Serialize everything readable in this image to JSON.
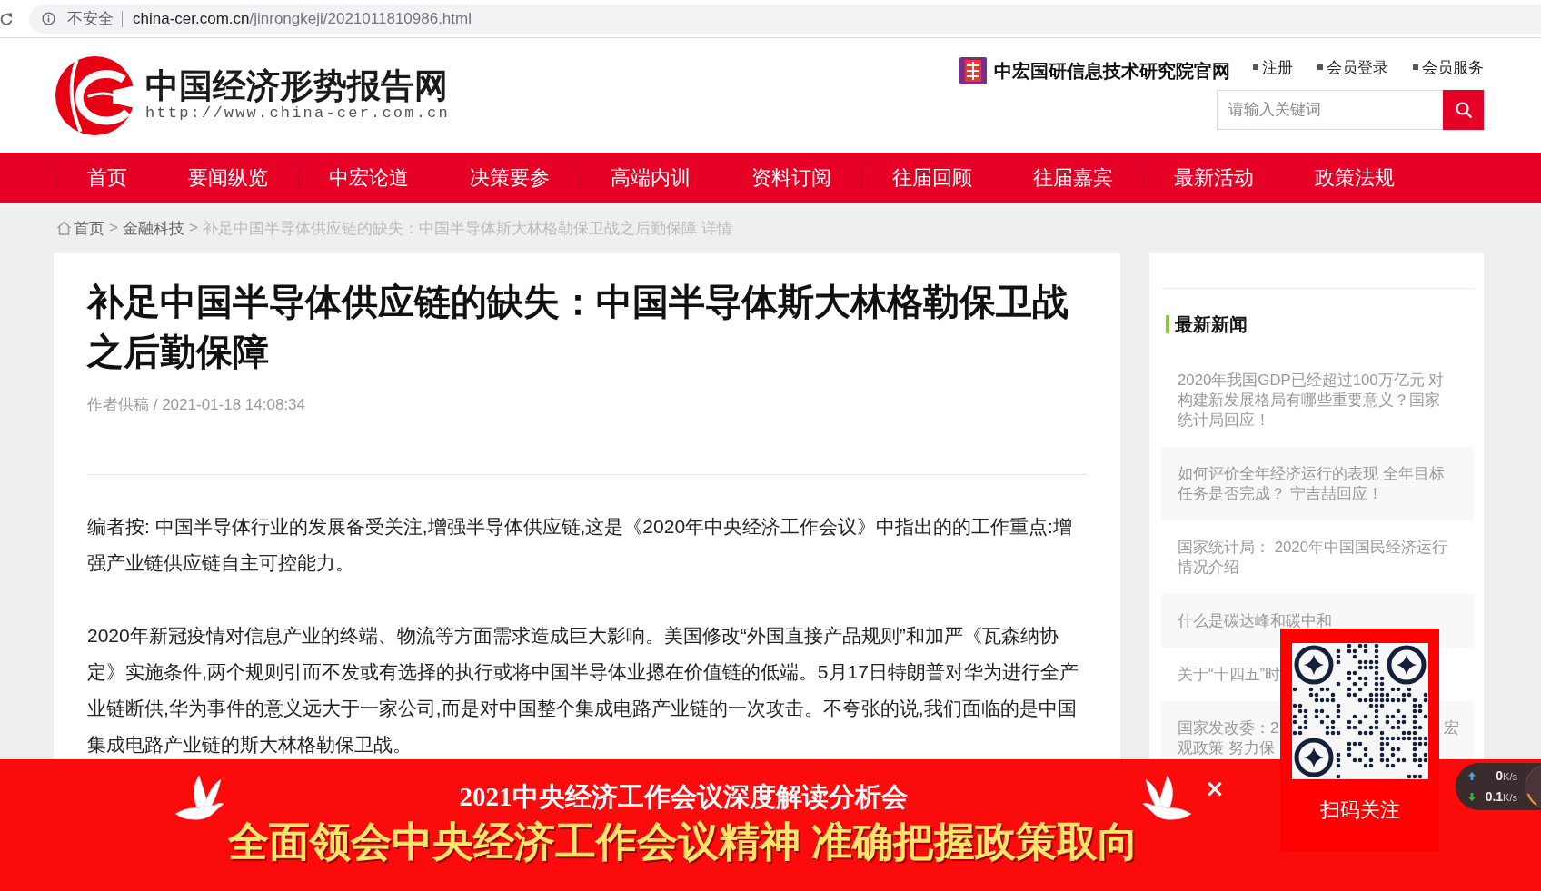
{
  "browser": {
    "security_label": "不安全",
    "url_host": "china-cer.com.cn",
    "url_path": "/jinrongkeji/2021011810986.html"
  },
  "header": {
    "site_title": "中国经济形势报告网",
    "site_url": "http://www.china-cer.com.cn",
    "institute_link": "中宏国研信息技术研究院官网",
    "user_links": [
      "注册",
      "会员登录",
      "会员服务"
    ],
    "search": {
      "placeholder": "请输入关键词"
    }
  },
  "nav": [
    "首页",
    "要闻纵览",
    "中宏论道",
    "决策要参",
    "高端内训",
    "资料订阅",
    "往届回顾",
    "往届嘉宾",
    "最新活动",
    "政策法规"
  ],
  "breadcrumb": [
    {
      "kind": "home",
      "label": "首页"
    },
    {
      "kind": "link",
      "separator": ">",
      "label": "金融科技"
    },
    {
      "kind": "current",
      "separator": ">",
      "label": "补足中国半导体供应链的缺失：中国半导体斯大林格勒保卫战之后勤保障 详情"
    }
  ],
  "article": {
    "title": "补足中国半导体供应链的缺失：中国半导体斯大林格勒保卫战之后勤保障",
    "meta": "作者供稿 / 2021-01-18 14:08:34",
    "paragraphs": [
      "编者按: 中国半导体行业的发展备受关注,增强半导体供应链,这是《2020年中央经济工作会议》中指出的的工作重点:增强产业链供应链自主可控能力。",
      "2020年新冠疫情对信息产业的终端、物流等方面需求造成巨大影响。美国修改“外国直接产品规则”和加严《瓦森纳协定》实施条件,两个规则引而不发或有选择的执行或将中国半导体业摁在价值链的低端。5月17日特朗普对华为进行全产业链断供,华为事件的意义远大于一家公司,而是对中国整个集成电路产业链的一次攻击。不夸张的说,我们面临的是中国集成电路产业链的斯大林格勒保卫战。"
    ]
  },
  "sidebar": {
    "heading": "最新新闻",
    "news": [
      {
        "kind": "full",
        "text": "2020年我国GDP已经超过100万亿元 对构建新发展格局有哪些重要意义？国家统计局回应！"
      },
      {
        "kind": "full",
        "text": "如何评价全年经济运行的表现 全年目标任务是否完成？ 宁吉喆回应！"
      },
      {
        "kind": "full",
        "text": "国家统计局： 2020年中国国民经济运行情况介绍"
      },
      {
        "kind": "full",
        "text": "什么是碳达峰和碳中和"
      },
      {
        "kind": "covered",
        "lines": [
          "关于“十四五”时"
        ]
      },
      {
        "kind": "covered",
        "lines": [
          "国家发改委：2",
          "观政策 努力保"
        ],
        "tail": "宏"
      }
    ]
  },
  "banner": {
    "title": "2021中央经济工作会议深度解读分析会",
    "slogan": "全面领会中央经济工作会议精神 准确把握政策取向",
    "close": "×"
  },
  "qr_popup": {
    "caption": "扫码关注"
  },
  "speed_widget": [
    {
      "kind": "up",
      "value": "0",
      "unit": "K/s"
    },
    {
      "kind": "down",
      "value": "0.1",
      "unit": "K/s"
    }
  ]
}
